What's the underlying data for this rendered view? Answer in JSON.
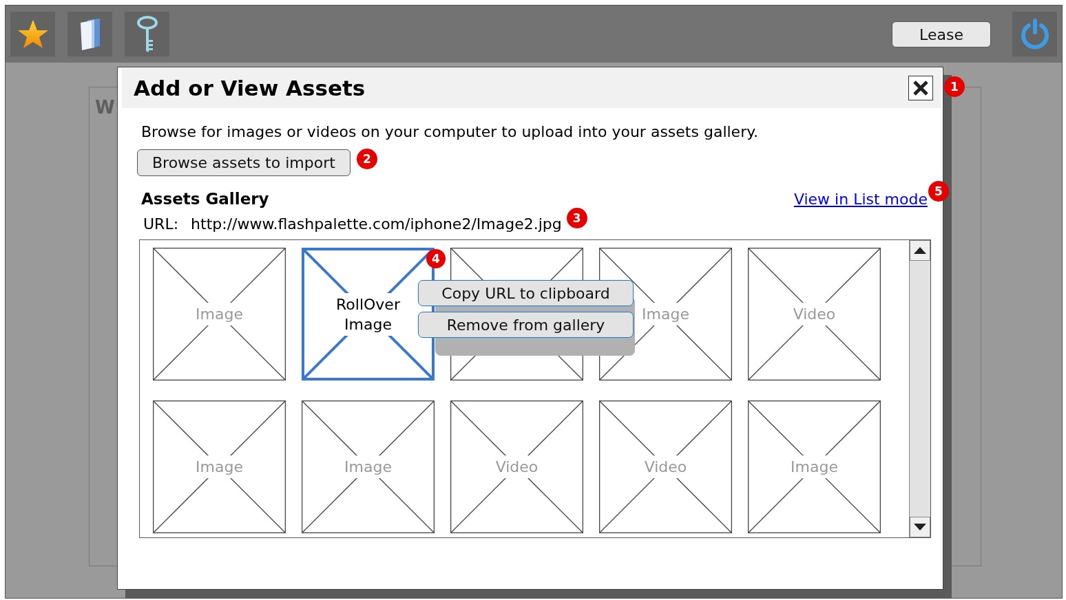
{
  "toolbar": {
    "icons": [
      {
        "kind": "star"
      },
      {
        "kind": "folder"
      },
      {
        "kind": "key"
      }
    ],
    "lease_button": "Lease",
    "power_button": {
      "kind": "power"
    }
  },
  "background": {
    "heading": "W"
  },
  "dialog": {
    "title": "Add or View Assets",
    "close_button": {
      "callout": "1"
    },
    "description": "Browse for images or videos on your computer to upload into your assets gallery.",
    "browse_button": {
      "label": "Browse assets to import",
      "callout": "2"
    },
    "gallery_title": "Assets Gallery",
    "list_mode_link": {
      "label": "View in List mode",
      "callout": "5"
    },
    "url_label": "URL:",
    "url": {
      "text": "http://www.flashpalette.com/iphone2/Image2.jpg",
      "callout": "3"
    },
    "tiles": [
      {
        "label": "Image",
        "selected": false
      },
      {
        "label": "RollOver Image",
        "selected": true,
        "callout": "4"
      },
      {
        "selected": false
      },
      {
        "label": "Image",
        "selected": false
      },
      {
        "label": "Video",
        "selected": false
      },
      {
        "label": "Image",
        "selected": false
      },
      {
        "label": "Image",
        "selected": false
      },
      {
        "label": "Video",
        "selected": false
      },
      {
        "label": "Video",
        "selected": false
      },
      {
        "label": "Image",
        "selected": false
      }
    ],
    "context_menu": [
      "Copy URL to clipboard",
      "Remove from gallery"
    ]
  }
}
